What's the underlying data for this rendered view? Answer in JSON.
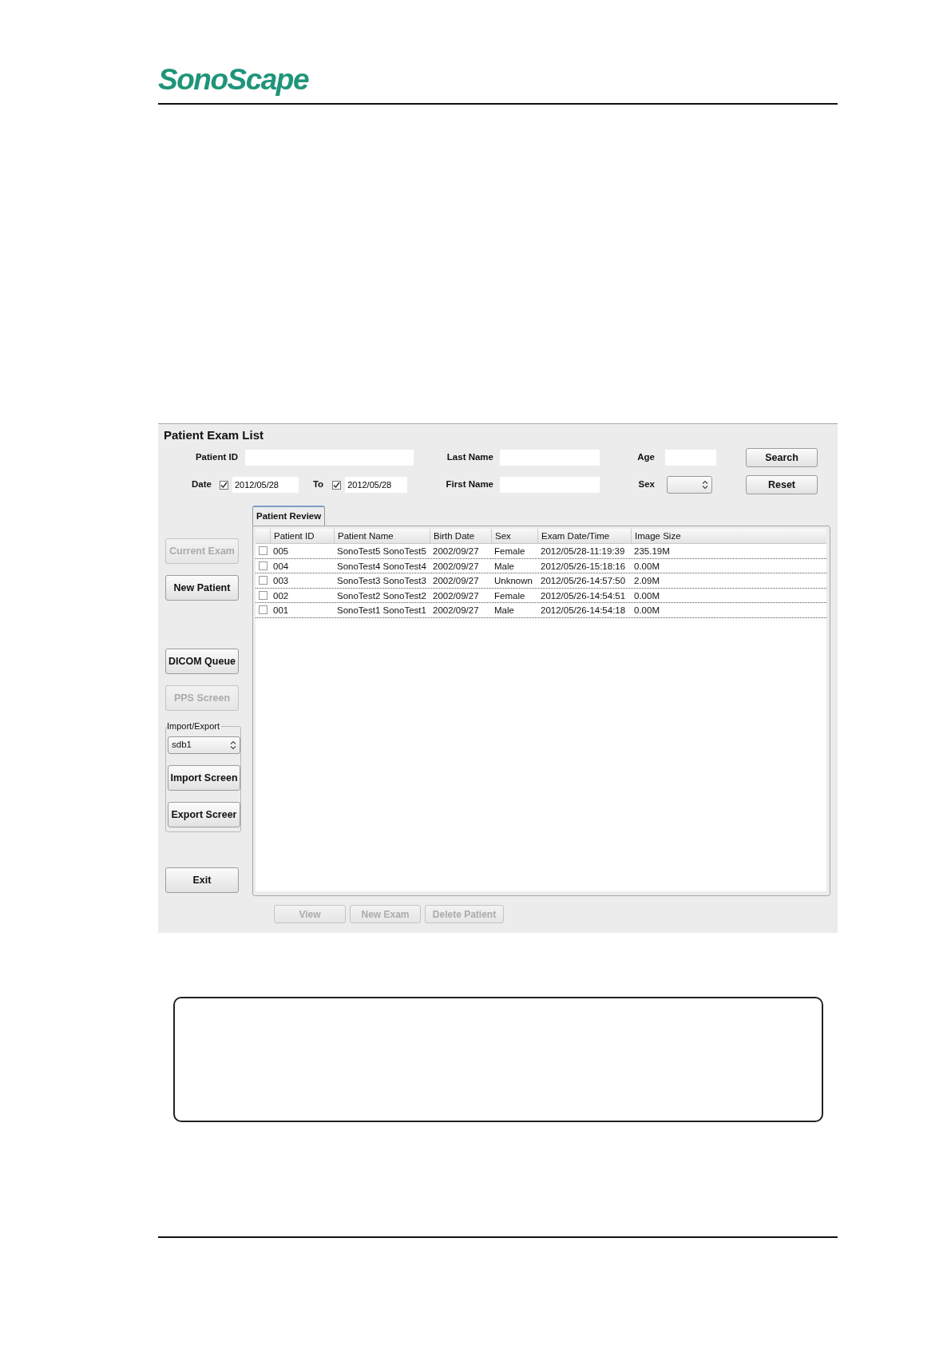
{
  "header": {
    "logo": "SonoScape"
  },
  "window": {
    "title": "Patient Exam List"
  },
  "search_form": {
    "patient_id": {
      "label": "Patient ID"
    },
    "date_from": {
      "label": "Date",
      "checked": true,
      "value": "2012/05/28"
    },
    "date_to": {
      "label": "To",
      "checked": true,
      "value": "2012/05/28"
    },
    "last_name": {
      "label": "Last Name"
    },
    "first_name": {
      "label": "First Name"
    },
    "age": {
      "label": "Age"
    },
    "sex": {
      "label": "Sex"
    },
    "buttons": [
      {
        "label": "Search",
        "disabled": false
      },
      {
        "label": "Reset",
        "disabled": false
      }
    ]
  },
  "side_buttons": [
    {
      "label": "Current Exam",
      "disabled": true
    },
    {
      "label": "New Patient",
      "disabled": false
    },
    {
      "label": "DICOM Queue",
      "disabled": false
    },
    {
      "label": "PPS Screen",
      "disabled": true
    }
  ],
  "import_export": {
    "title": "Import/Export",
    "device": "sdb1",
    "buttons": [
      {
        "label": "Import Screen",
        "disabled": false
      },
      {
        "label": "Export Screer",
        "disabled": false
      }
    ]
  },
  "exit_button": {
    "label": "Exit",
    "disabled": false
  },
  "tabs": [
    {
      "label": "Patient Review",
      "selected": true
    }
  ],
  "table": {
    "columns": [
      "Patient ID",
      "Patient Name",
      "Birth Date",
      "Sex",
      "Exam Date/Time",
      "Image Size"
    ],
    "rows": [
      {
        "checked": false,
        "cells": [
          "005",
          "SonoTest5 SonoTest5",
          "2002/09/27",
          "Female",
          "2012/05/28-11:19:39",
          "235.19M"
        ]
      },
      {
        "checked": false,
        "cells": [
          "004",
          "SonoTest4 SonoTest4",
          "2002/09/27",
          "Male",
          "2012/05/26-15:18:16",
          "0.00M"
        ]
      },
      {
        "checked": false,
        "cells": [
          "003",
          "SonoTest3 SonoTest3",
          "2002/09/27",
          "Unknown",
          "2012/05/26-14:57:50",
          "2.09M"
        ]
      },
      {
        "checked": false,
        "cells": [
          "002",
          "SonoTest2 SonoTest2",
          "2002/09/27",
          "Female",
          "2012/05/26-14:54:51",
          "0.00M"
        ]
      },
      {
        "checked": false,
        "cells": [
          "001",
          "SonoTest1 SonoTest1",
          "2002/09/27",
          "Male",
          "2012/05/26-14:54:18",
          "0.00M"
        ]
      }
    ]
  },
  "bottom_buttons": [
    {
      "label": "View",
      "disabled": true
    },
    {
      "label": "New Exam",
      "disabled": true
    },
    {
      "label": "Delete Patient",
      "disabled": true
    }
  ]
}
